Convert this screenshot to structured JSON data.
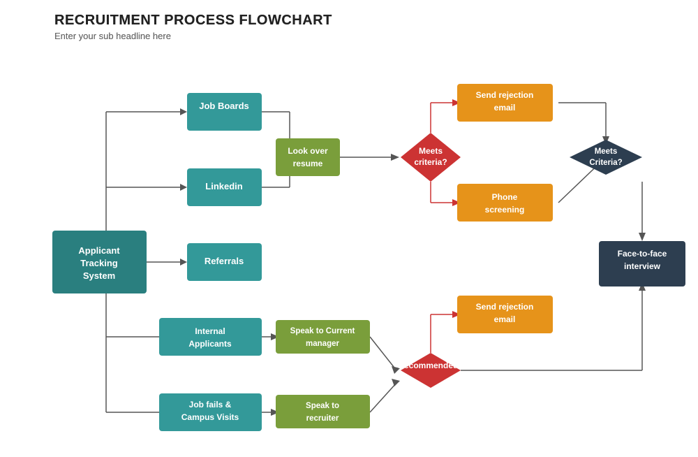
{
  "header": {
    "title": "RECRUITMENT PROCESS FLOWCHART",
    "subtitle": "Enter your sub headline here"
  },
  "nodes": {
    "ats": {
      "label": "Applicant\nTracking\nSystem"
    },
    "jobBoards": {
      "label": "Job Boards"
    },
    "linkedin": {
      "label": "Linkedin"
    },
    "referrals": {
      "label": "Referrals"
    },
    "internalApplicants": {
      "label": "Internal\nApplicants"
    },
    "jobFails": {
      "label": "Job fails &\nCampus Visits"
    },
    "lookOverResume": {
      "label": "Look over\nresume"
    },
    "speakToCurrentManager": {
      "label": "Speak to Current\nmanager"
    },
    "speakToRecruiter": {
      "label": "Speak to\nrecruiter"
    },
    "meetsCriteria1": {
      "label": "Meets\ncriteria?"
    },
    "recommended": {
      "label": "Recommended?"
    },
    "sendRejectionEmail1": {
      "label": "Send rejection\nemail"
    },
    "phoneScreening": {
      "label": "Phone\nscreening"
    },
    "sendRejectionEmail2": {
      "label": "Send rejection\nemail"
    },
    "meetsCriteria2": {
      "label": "Meets\nCriteria?"
    },
    "faceToFace": {
      "label": "Face-to-face\ninterview"
    }
  },
  "colors": {
    "teal_dark": "#2a7f7f",
    "teal_medium": "#339999",
    "green_olive": "#7a9e3b",
    "orange": "#e6931a",
    "red_diamond": "#cc3333",
    "navy_diamond": "#2d3e50",
    "navy_rect": "#2d3e50",
    "line_color": "#555555",
    "line_red": "#cc3333"
  }
}
